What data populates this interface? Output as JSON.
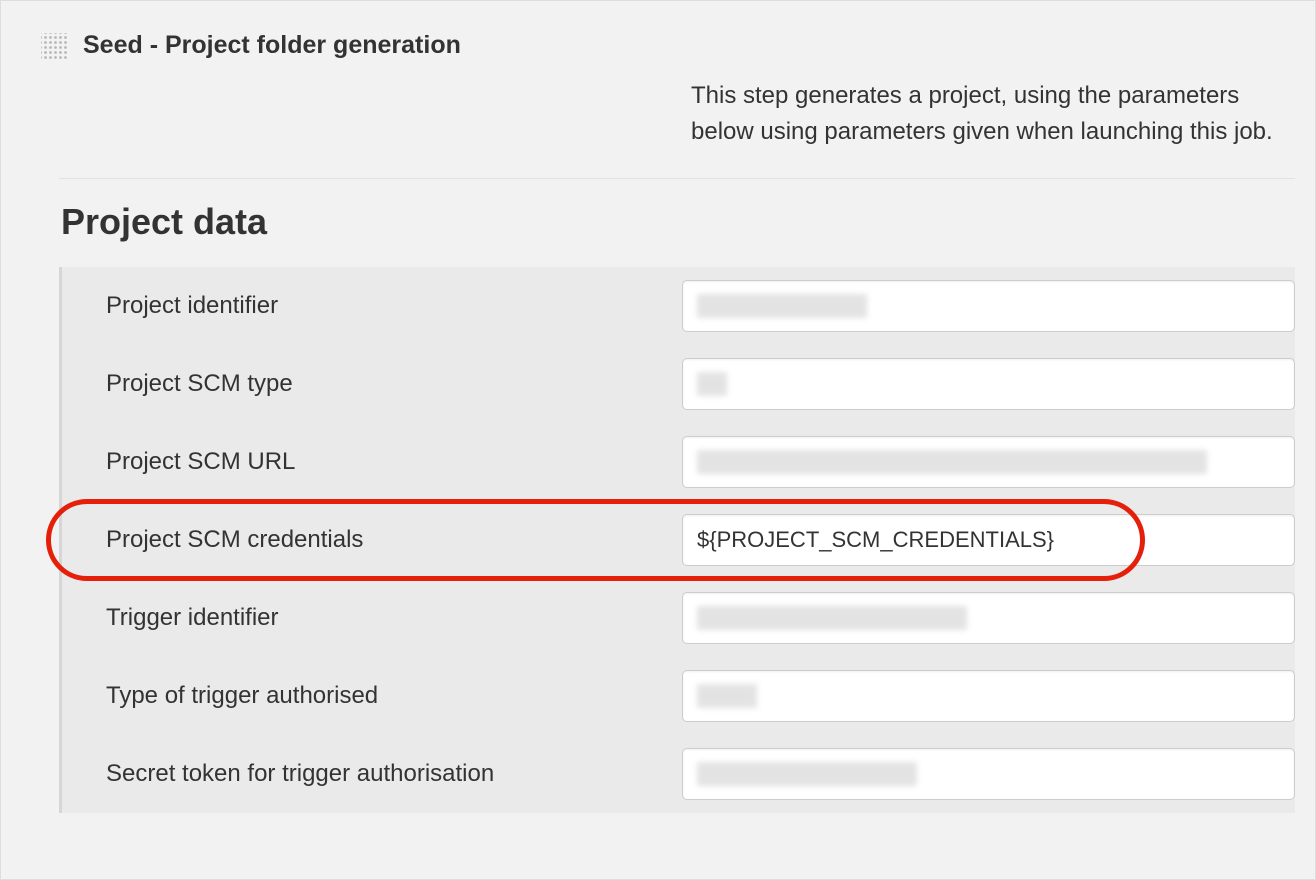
{
  "header": {
    "title": "Seed - Project folder generation"
  },
  "description": "This step generates a project, using the parameters below using parameters given when launching this job.",
  "section": {
    "title": "Project data"
  },
  "fields": [
    {
      "label": "Project identifier",
      "value": "",
      "redactedWidth": 170,
      "highlighted": false
    },
    {
      "label": "Project SCM type",
      "value": "",
      "redactedWidth": 30,
      "highlighted": false
    },
    {
      "label": "Project SCM URL",
      "value": "",
      "redactedWidth": 510,
      "highlighted": false
    },
    {
      "label": "Project SCM credentials",
      "value": "${PROJECT_SCM_CREDENTIALS}",
      "redactedWidth": 0,
      "highlighted": true
    },
    {
      "label": "Trigger identifier",
      "value": "",
      "redactedWidth": 270,
      "highlighted": false
    },
    {
      "label": "Type of trigger authorised",
      "value": "",
      "redactedWidth": 60,
      "highlighted": false
    },
    {
      "label": "Secret token for trigger authorisation",
      "value": "",
      "redactedWidth": 220,
      "highlighted": false
    }
  ]
}
